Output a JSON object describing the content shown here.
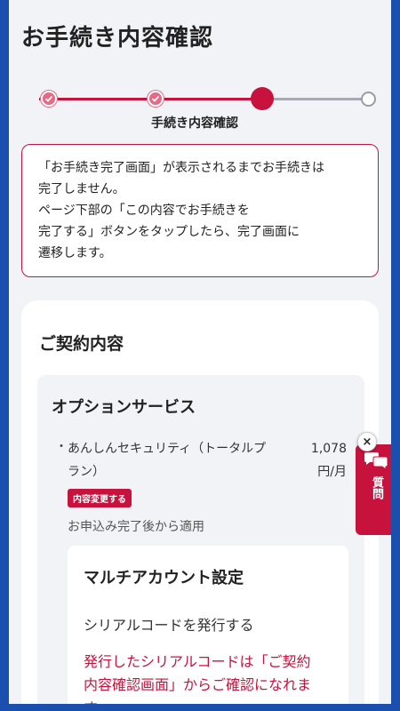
{
  "header": {
    "title": "お手続き内容確認"
  },
  "stepper": {
    "current_step_label": "手続き内容確認"
  },
  "notice": {
    "lines": [
      "「お手続き完了画面」が表示されるまでお手続きは",
      "完了しません。",
      "ページ下部の「この内容でお手続きを",
      "完了する」ボタンをタップしたら、完了画面に",
      "遷移します。"
    ]
  },
  "contract": {
    "title": "ご契約内容",
    "option": {
      "title": "オプションサービス",
      "item_name": "あんしんセキュリティ（トータルプラン）",
      "item_price": "1,078 円/月",
      "badge": "内容変更する",
      "apply_note": "お申込み完了後から適用"
    },
    "multi_account": {
      "title": "マルチアカウント設定",
      "serial_label": "シリアルコードを発行する",
      "note_lines": [
        "発行したシリアルコードは「ご契約",
        "内容確認画面」からご確認になれま",
        "す。"
      ]
    }
  },
  "help": {
    "label": "質問",
    "close": "×"
  },
  "colors": {
    "accent": "#c8123e",
    "frame": "#1b4fae",
    "background": "#f2f3f6"
  }
}
